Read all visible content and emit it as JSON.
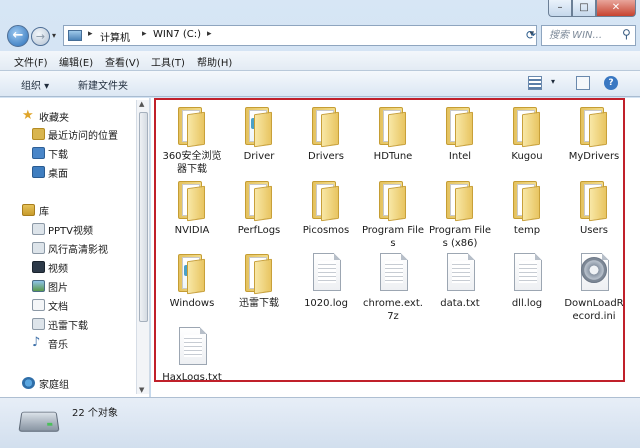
{
  "window": {
    "controls": {
      "minimize": "–",
      "maximize": "□",
      "close": "✕"
    }
  },
  "navigation": {
    "back_glyph": "←",
    "forward_glyph": "→",
    "breadcrumbs": [
      "计算机",
      "WIN7 (C:)"
    ],
    "search_placeholder": "搜索 WIN...",
    "icons": [
      "back-icon",
      "forward-icon",
      "computer-icon",
      "refresh-icon",
      "search-icon"
    ]
  },
  "menubar": {
    "items": [
      "文件(F)",
      "编辑(E)",
      "查看(V)",
      "工具(T)",
      "帮助(H)"
    ]
  },
  "toolbar": {
    "organize": "组织 ▾",
    "new_folder": "新建文件夹"
  },
  "sidebar": {
    "favorites": {
      "label": "收藏夹",
      "items": [
        "最近访问的位置",
        "下载",
        "桌面"
      ]
    },
    "libraries": {
      "label": "库",
      "items": [
        "PPTV视频",
        "风行高清影视",
        "视频",
        "图片",
        "文档",
        "迅雷下载",
        "音乐"
      ]
    },
    "homegroup": {
      "label": "家庭组"
    }
  },
  "files": [
    {
      "name": "360安全浏览器下载",
      "kind": "folder"
    },
    {
      "name": "Driver",
      "kind": "folder-doc"
    },
    {
      "name": "Drivers",
      "kind": "folder"
    },
    {
      "name": "HDTune",
      "kind": "folder"
    },
    {
      "name": "Intel",
      "kind": "folder"
    },
    {
      "name": "Kugou",
      "kind": "folder"
    },
    {
      "name": "MyDrivers",
      "kind": "folder"
    },
    {
      "name": "NVIDIA",
      "kind": "folder"
    },
    {
      "name": "PerfLogs",
      "kind": "folder"
    },
    {
      "name": "Picosmos",
      "kind": "folder"
    },
    {
      "name": "Program Files",
      "kind": "folder"
    },
    {
      "name": "Program Files (x86)",
      "kind": "folder"
    },
    {
      "name": "temp",
      "kind": "folder"
    },
    {
      "name": "Users",
      "kind": "folder"
    },
    {
      "name": "Windows",
      "kind": "folder-doc"
    },
    {
      "name": "迅雷下载",
      "kind": "folder"
    },
    {
      "name": "1020.log",
      "kind": "file"
    },
    {
      "name": "chrome.ext.7z",
      "kind": "file"
    },
    {
      "name": "data.txt",
      "kind": "file"
    },
    {
      "name": "dll.log",
      "kind": "file"
    },
    {
      "name": "DownLoadRecord.ini",
      "kind": "settings"
    },
    {
      "name": "HaxLogs.txt",
      "kind": "file"
    }
  ],
  "status": {
    "count_text": "22 个对象"
  },
  "colors": {
    "highlight_border": "#c0202a",
    "folder": "#e8c561"
  }
}
